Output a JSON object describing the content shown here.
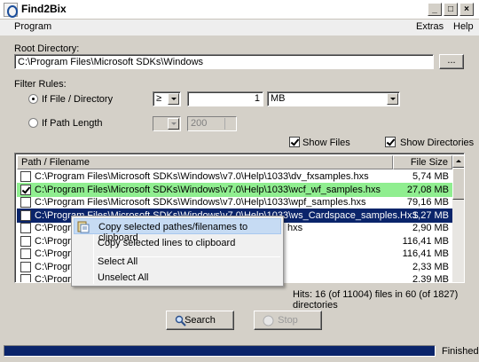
{
  "window": {
    "title": "Find2Bix",
    "controls": {
      "minimize": "_",
      "maximize": "□",
      "close": "×"
    }
  },
  "menu": {
    "program": "Program",
    "extras": "Extras",
    "help": "Help"
  },
  "root": {
    "label": "Root Directory:",
    "value": "C:\\Program Files\\Microsoft SDKs\\Windows",
    "browse": "..."
  },
  "filter": {
    "label": "Filter Rules:",
    "file_dir_label": "If File / Directory",
    "operator": "≥",
    "size_value": "1",
    "unit": "MB",
    "path_length_label": "If Path Length",
    "path_length_value": "200",
    "show_files": "Show Files",
    "show_dirs": "Show Directories"
  },
  "table": {
    "columns": {
      "path": "Path / Filename",
      "size": "File Size"
    },
    "rows": [
      {
        "path": "C:\\Program Files\\Microsoft SDKs\\Windows\\v7.0\\Help\\1033\\dv_fxsamples.hxs",
        "size": "5,74 MB",
        "checked": false,
        "state": "normal"
      },
      {
        "path": "C:\\Program Files\\Microsoft SDKs\\Windows\\v7.0\\Help\\1033\\wcf_wf_samples.hxs",
        "size": "27,08 MB",
        "checked": true,
        "state": "green"
      },
      {
        "path": "C:\\Program Files\\Microsoft SDKs\\Windows\\v7.0\\Help\\1033\\wpf_samples.hxs",
        "size": "79,16 MB",
        "checked": false,
        "state": "normal"
      },
      {
        "path": "C:\\Program Files\\Microsoft SDKs\\Windows\\v7.0\\Help\\1033\\ws_Cardspace_samples.HxS",
        "size": "1,27 MB",
        "checked": false,
        "state": "selected"
      },
      {
        "path": "C:\\Progra",
        "size": "2,90 MB",
        "checked": false,
        "state": "normal",
        "tail": "hxs"
      },
      {
        "path": "C:\\Progra",
        "size": "116,41 MB",
        "checked": false,
        "state": "normal"
      },
      {
        "path": "C:\\Progra",
        "size": "116,41 MB",
        "checked": false,
        "state": "normal"
      },
      {
        "path": "C:\\Progra",
        "size": "2,33 MB",
        "checked": false,
        "state": "normal"
      },
      {
        "path": "C:\\Progra",
        "size": "2,39 MB",
        "checked": false,
        "state": "normal"
      }
    ]
  },
  "context_menu": {
    "items": [
      "Copy selected pathes/filenames to clipboard",
      "Copy selected lines  to clipboard",
      "Select All",
      "Unselect All"
    ]
  },
  "hits": "Hits: 16 (of 11004) files in 60 (of 1827) directories",
  "buttons": {
    "search": "Search",
    "stop": "Stop"
  },
  "status": {
    "text": "Finished.",
    "progress": 1.0
  },
  "colors": {
    "highlight": "#0a246a",
    "green_row": "#90ee90",
    "menu_hover": "#c6dbf3"
  }
}
